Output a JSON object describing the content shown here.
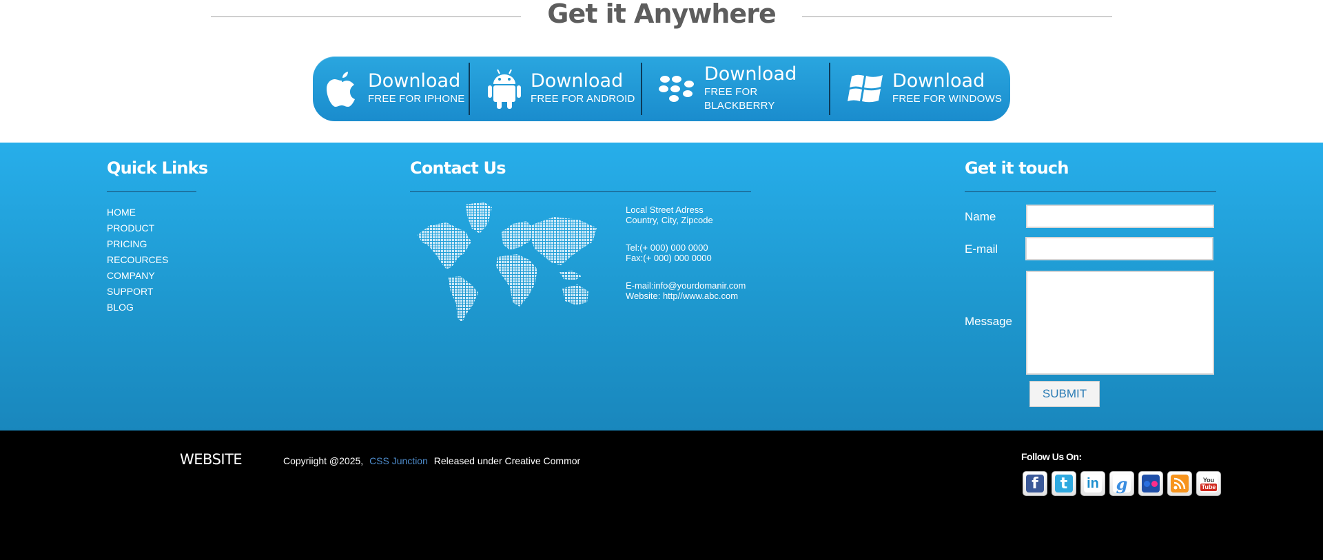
{
  "get_it": {
    "title": "Get it Anywhere"
  },
  "downloads": [
    {
      "icon": "apple-icon",
      "main": "Download",
      "sub": "FREE FOR IPHONE"
    },
    {
      "icon": "android-icon",
      "main": "Download",
      "sub": "FREE FOR ANDROID"
    },
    {
      "icon": "blackberry-icon",
      "main": "Download",
      "sub": "FREE FOR BLACKBERRY"
    },
    {
      "icon": "windows-icon",
      "main": "Download",
      "sub": "FREE FOR WINDOWS"
    }
  ],
  "quick_links": {
    "title": "Quick Links",
    "items": [
      "HOME",
      "PRODUCT",
      "PRICING",
      "RECOURCES",
      "COMPANY",
      "SUPPORT",
      "BLOG"
    ]
  },
  "contact": {
    "title": "Contact Us",
    "address1": "Local Street Adress",
    "address2": "Country, City, Zipcode",
    "tel": "Tel:(+ 000) 000 0000",
    "fax": "Fax:(+ 000) 000 0000",
    "email": "E-mail:info@yourdomanir.com",
    "website": "Website: http//www.abc.com"
  },
  "touch": {
    "title": "Get it touch",
    "name_label": "Name",
    "email_label": "E-mail",
    "message_label": "Message",
    "submit_label": "SUBMIT"
  },
  "bottom": {
    "site_name": "WEBSITE",
    "copyright_prefix": "Copyriight @2025,",
    "link_text": "CSS Junction",
    "copyright_suffix": "Released under Creative Commor",
    "follow_label": "Follow Us On:"
  },
  "colors": {
    "accent_blue": "#1e98cf",
    "title_gray": "#5d5d5d",
    "link_blue": "#4e8ccc"
  }
}
